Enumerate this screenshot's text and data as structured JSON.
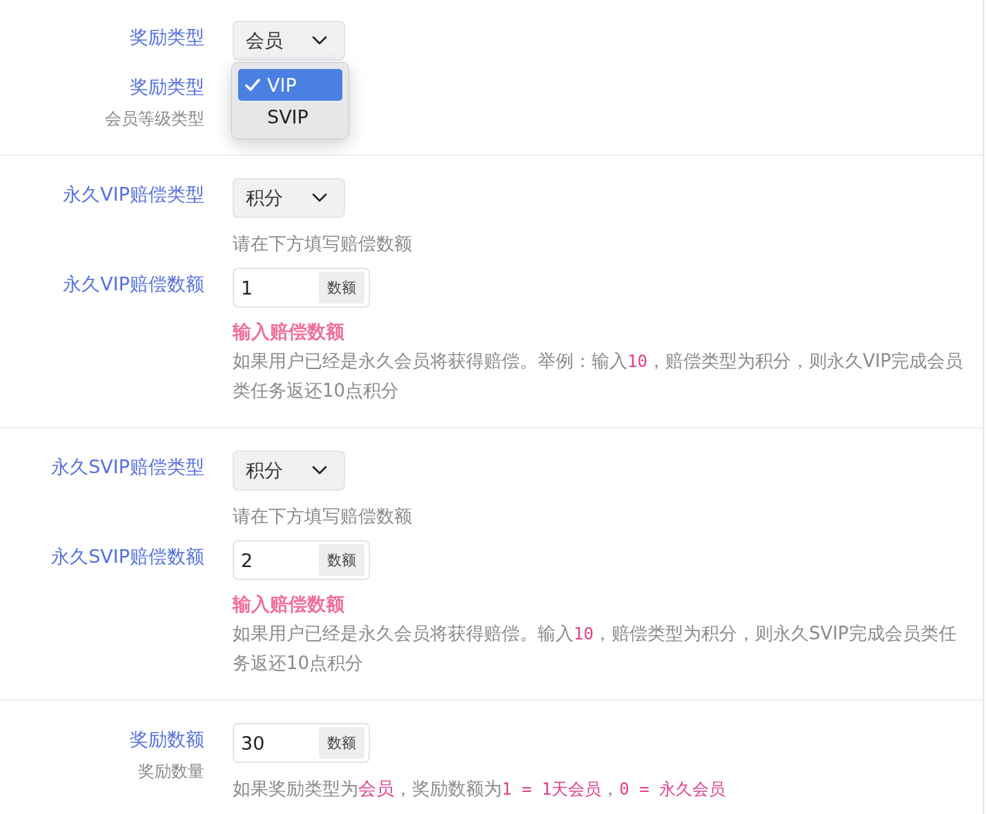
{
  "sections": [
    {
      "fields": [
        {
          "label": "奖励类型",
          "select": {
            "value": "会员"
          }
        },
        {
          "label": "奖励类型",
          "sublabel": "会员等级类型",
          "menu": {
            "options": [
              {
                "label": "VIP",
                "selected": true
              },
              {
                "label": "SVIP",
                "selected": false
              }
            ]
          }
        }
      ]
    },
    {
      "fields": [
        {
          "label": "永久VIP赔偿类型",
          "select": {
            "value": "积分"
          },
          "help": "请在下方填写赔偿数额"
        },
        {
          "label": "永久VIP赔偿数额",
          "input": {
            "value": "1",
            "addon": "数额"
          },
          "error": "输入赔偿数额",
          "description": [
            {
              "kind": "text",
              "text": "如果用户已经是永久会员将获得赔偿。举例：输入"
            },
            {
              "kind": "code",
              "text": "10"
            },
            {
              "kind": "text",
              "text": "，赔偿类型为积分，则永久VIP完成会员类任务返还10点积分"
            }
          ]
        }
      ]
    },
    {
      "fields": [
        {
          "label": "永久SVIP赔偿类型",
          "select": {
            "value": "积分"
          },
          "help": "请在下方填写赔偿数额"
        },
        {
          "label": "永久SVIP赔偿数额",
          "input": {
            "value": "2",
            "addon": "数额"
          },
          "error": "输入赔偿数额",
          "description": [
            {
              "kind": "text",
              "text": "如果用户已经是永久会员将获得赔偿。输入"
            },
            {
              "kind": "code",
              "text": "10"
            },
            {
              "kind": "text",
              "text": "，赔偿类型为积分，则永久SVIP完成会员类任务返还10点积分"
            }
          ]
        }
      ]
    },
    {
      "fields": [
        {
          "label": "奖励数额",
          "sublabel": "奖励数量",
          "input": {
            "value": "30",
            "addon": "数额"
          },
          "description": [
            {
              "kind": "text",
              "text": "如果奖励类型为"
            },
            {
              "kind": "em",
              "text": "会员"
            },
            {
              "kind": "text",
              "text": "，奖励数额为"
            },
            {
              "kind": "code",
              "text": "1 = 1天会员"
            },
            {
              "kind": "text",
              "text": "，"
            },
            {
              "kind": "code",
              "text": "0 = 永久会员"
            }
          ]
        }
      ]
    }
  ]
}
